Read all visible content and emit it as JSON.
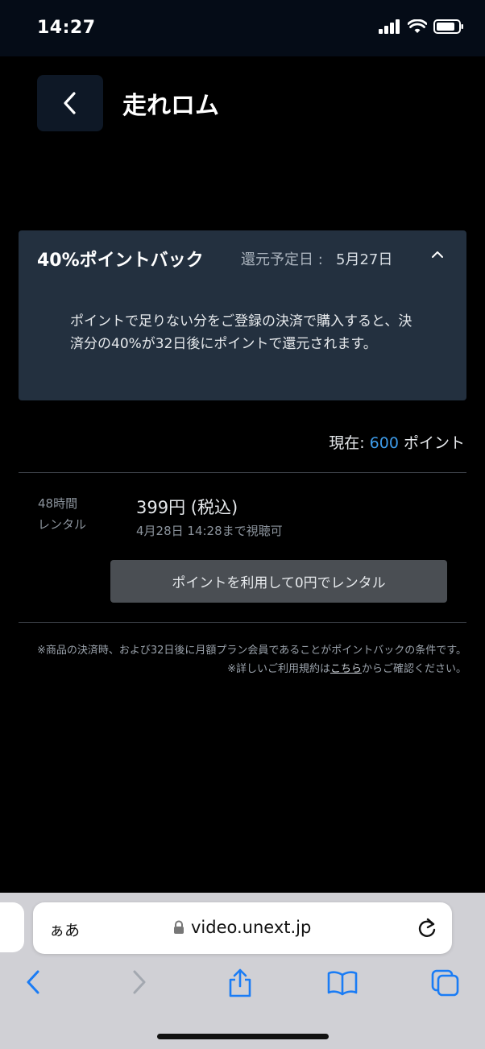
{
  "status": {
    "time": "14:27"
  },
  "header": {
    "title": "走れロム"
  },
  "pointback": {
    "title": "40%ポイントバック",
    "date_label": "還元予定日 :",
    "date": "5月27日",
    "description": "ポイントで足りない分をご登録の決済で購入すると、決済分の40%が32日後にポイントで還元されます。"
  },
  "points": {
    "prefix": "現在:",
    "value": "600",
    "suffix": "ポイント"
  },
  "rental": {
    "duration_line1": "48時間",
    "duration_line2": "レンタル",
    "price": "399円 (税込)",
    "deadline": "4月28日 14:28まで視聴可",
    "button_label": "ポイントを利用して0円でレンタル"
  },
  "notes": {
    "line1": "※商品の決済時、および32日後に月額プラン会員であることがポイントバックの条件です。",
    "line2_prefix": "※詳しいご利用規約は",
    "line2_link": "こちら",
    "line2_suffix": "からご確認ください。"
  },
  "browser": {
    "aa_label": "ぁあ",
    "url": "video.unext.jp"
  },
  "colors": {
    "accent": "#3d9be9",
    "ios_blue": "#1a7cf5"
  }
}
